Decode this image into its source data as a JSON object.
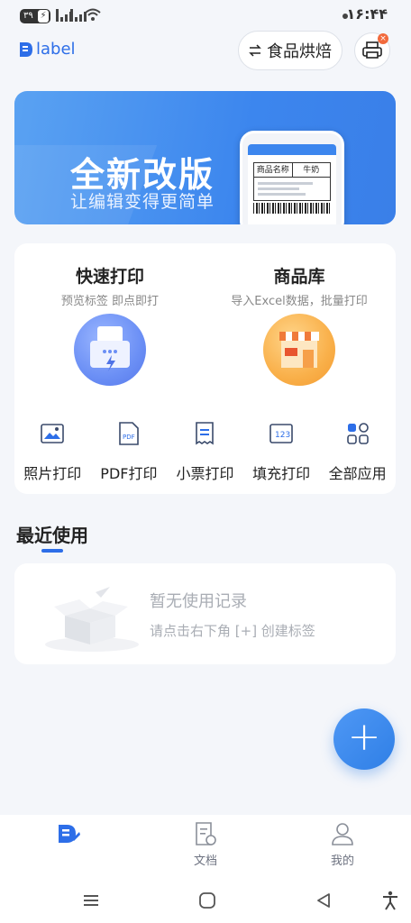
{
  "status_bar": {
    "battery": "۳۹",
    "time": "۱۶:۴۴"
  },
  "header": {
    "logo_text": "label",
    "category_label": "食品烘焙",
    "printer_badge": "×"
  },
  "banner": {
    "title": "全新改版",
    "subtitle": "让编辑变得更简单",
    "label_sample": {
      "header_left": "商品名称",
      "header_right": "牛奶"
    }
  },
  "quick_actions": {
    "quick_print": {
      "title": "快速打印",
      "subtitle": "预览标签 即点即打"
    },
    "product_library": {
      "title": "商品库",
      "subtitle": "导入Excel数据，批量打印"
    },
    "shortcuts": [
      {
        "label": "照片打印",
        "icon": "image-icon"
      },
      {
        "label": "PDF打印",
        "icon": "pdf-icon"
      },
      {
        "label": "小票打印",
        "icon": "receipt-icon"
      },
      {
        "label": "填充打印",
        "icon": "fill-print-icon"
      },
      {
        "label": "全部应用",
        "icon": "all-apps-icon"
      }
    ]
  },
  "recent": {
    "title": "最近使用",
    "empty_title": "暂无使用记录",
    "empty_hint": "请点击右下角 [+] 创建标签"
  },
  "fab": {
    "label": "+"
  },
  "bottom_nav": {
    "items": [
      {
        "label": "",
        "icon": "home-logo-icon",
        "active": true
      },
      {
        "label": "文档",
        "icon": "document-icon"
      },
      {
        "label": "我的",
        "icon": "profile-icon"
      }
    ]
  },
  "colors": {
    "accent": "#2d6ee8",
    "badge": "#f26a3c",
    "background": "#f4f6fa"
  }
}
